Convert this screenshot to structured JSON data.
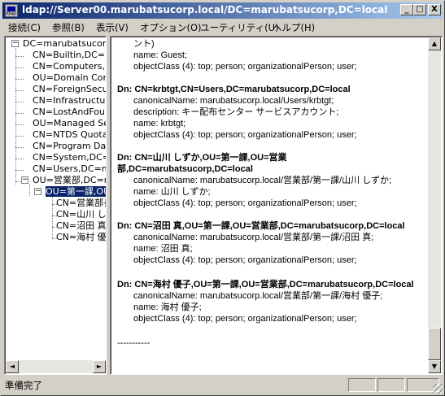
{
  "window": {
    "title": "ldap://Server00.marubatsucorp.local/DC=marubatsucorp,DC=local",
    "icon_text": "ldap",
    "controls": {
      "minimize": "_",
      "maximize": "□",
      "close": "X"
    }
  },
  "menu": [
    "接続(C)",
    "参照(B)",
    "表示(V)",
    "オプション(O)",
    "ユーティリティ(U)",
    "ヘルプ(H)"
  ],
  "tree": {
    "nodes": [
      {
        "label": "DC=marubatsucorp,DC=local",
        "expander": "−"
      },
      {
        "label": "CN=Builtin,DC=marubatsucorp,DC=local"
      },
      {
        "label": "CN=Computers,DC=marubatsucorp,DC=local"
      },
      {
        "label": "OU=Domain Controllers,DC=marubatsucorp,DC=local"
      },
      {
        "label": "CN=ForeignSecurityPrincipals,DC=marubatsucorp,DC=local"
      },
      {
        "label": "CN=Infrastructure,DC=marubatsucorp,DC=local"
      },
      {
        "label": "CN=LostAndFound,DC=marubatsucorp,DC=local"
      },
      {
        "label": "OU=Managed Service Accounts,DC=marubatsucorp,DC=local"
      },
      {
        "label": "CN=NTDS Quotas,DC=marubatsucorp,DC=local"
      },
      {
        "label": "CN=Program Data,DC=marubatsucorp,DC=local"
      },
      {
        "label": "CN=System,DC=marubatsucorp,DC=local"
      },
      {
        "label": "CN=Users,DC=marubatsucorp,DC=local"
      },
      {
        "label": "OU=営業部,DC=marubatsucorp,DC=local",
        "expander": "−"
      },
      {
        "label": "OU=第一課,OU=営業部,DC=marubatsucorp,DC=local",
        "expander": "−",
        "selected": true
      },
      {
        "label": "CN=営業部長,OU=第一課,OU=営業部,DC=marubatsucorp,DC=local"
      },
      {
        "label": "CN=山川 しずか,OU=第一課,OU=営業部,DC=marubatsucorp,DC=local"
      },
      {
        "label": "CN=沼田 真,OU=第一課,OU=営業部,DC=marubatsucorp,DC=local"
      },
      {
        "label": "CN=海村 優子,OU=第一課,OU=営業部,DC=marubatsucorp,DC=local"
      }
    ]
  },
  "results": {
    "lines": [
      {
        "kind": "attr",
        "text": "ント)"
      },
      {
        "kind": "attr",
        "text": "name: Guest;"
      },
      {
        "kind": "attr",
        "text": "objectClass (4): top; person; organizationalPerson; user;"
      },
      {
        "kind": "dn",
        "text": "Dn: CN=krbtgt,CN=Users,DC=marubatsucorp,DC=local"
      },
      {
        "kind": "attr",
        "text": "canonicalName: marubatsucorp.local/Users/krbtgt;"
      },
      {
        "kind": "attr",
        "text": "description: キー配布センター サービスアカウント;"
      },
      {
        "kind": "attr",
        "text": "name: krbtgt;"
      },
      {
        "kind": "attr",
        "text": "objectClass (4): top; person; organizationalPerson; user;"
      },
      {
        "kind": "dn",
        "text": "Dn: CN=山川 しずか,OU=第一課,OU=営業"
      },
      {
        "kind": "dn2",
        "text": "部,DC=marubatsucorp,DC=local"
      },
      {
        "kind": "attr",
        "text": "canonicalName: marubatsucorp.local/営業部/第一課/山川 しずか;"
      },
      {
        "kind": "attr",
        "text": "name: 山川 しずか;"
      },
      {
        "kind": "attr",
        "text": "objectClass (4): top; person; organizationalPerson; user;"
      },
      {
        "kind": "dn",
        "text": "Dn: CN=沼田 真,OU=第一課,OU=営業部,DC=marubatsucorp,DC=local"
      },
      {
        "kind": "attr",
        "text": "canonicalName: marubatsucorp.local/営業部/第一課/沼田 真;"
      },
      {
        "kind": "attr",
        "text": "name: 沼田 真;"
      },
      {
        "kind": "attr",
        "text": "objectClass (4): top; person; organizationalPerson; user;"
      },
      {
        "kind": "dn",
        "text": "Dn: CN=海村 優子,OU=第一課,OU=営業部,DC=marubatsucorp,DC=local"
      },
      {
        "kind": "attr",
        "text": "canonicalName: marubatsucorp.local/営業部/第一課/海村 優子;"
      },
      {
        "kind": "attr",
        "text": "name: 海村 優子;"
      },
      {
        "kind": "attr",
        "text": "objectClass (4): top; person; organizationalPerson; user;"
      },
      {
        "kind": "sep",
        "text": "-----------"
      }
    ]
  },
  "scroll": {
    "left_arrow": "◄",
    "right_arrow": "►",
    "up_arrow": "▲",
    "down_arrow": "▼"
  },
  "status": {
    "text": "準備完了"
  },
  "colors": {
    "titlebar_start": "#0a246a",
    "titlebar_end": "#a6caf0",
    "face": "#d4d0c8",
    "selection": "#0a246a"
  }
}
